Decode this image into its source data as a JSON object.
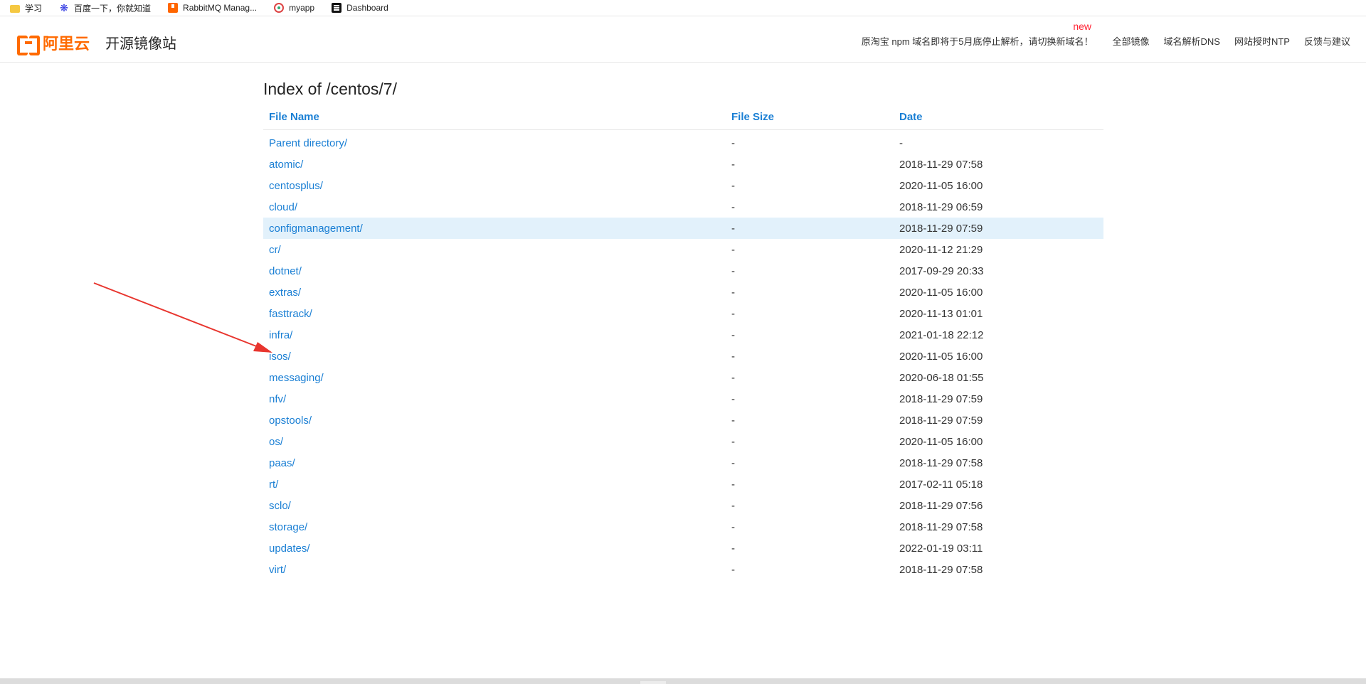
{
  "bookmarks": [
    {
      "label": "学习",
      "icon": "folder-icon"
    },
    {
      "label": "百度一下，你就知道",
      "icon": "baidu-paw-icon"
    },
    {
      "label": "RabbitMQ Manag...",
      "icon": "rabbitmq-icon"
    },
    {
      "label": "myapp",
      "icon": "myapp-icon"
    },
    {
      "label": "Dashboard",
      "icon": "dashboard-icon"
    }
  ],
  "header": {
    "logo_text": "阿里云",
    "site_title": "开源镜像站",
    "new_badge": "new",
    "notice": "原淘宝 npm 域名即将于5月底停止解析，请切换新域名！",
    "nav": [
      "全部镜像",
      "域名解析DNS",
      "网站授时NTP",
      "反馈与建议"
    ]
  },
  "listing": {
    "title": "Index of /centos/7/",
    "columns": [
      "File Name",
      "File Size",
      "Date"
    ],
    "rows": [
      {
        "name": "Parent directory/",
        "size": "-",
        "date": "-"
      },
      {
        "name": "atomic/",
        "size": "-",
        "date": "2018-11-29 07:58"
      },
      {
        "name": "centosplus/",
        "size": "-",
        "date": "2020-11-05 16:00"
      },
      {
        "name": "cloud/",
        "size": "-",
        "date": "2018-11-29 06:59"
      },
      {
        "name": "configmanagement/",
        "size": "-",
        "date": "2018-11-29 07:59"
      },
      {
        "name": "cr/",
        "size": "-",
        "date": "2020-11-12 21:29"
      },
      {
        "name": "dotnet/",
        "size": "-",
        "date": "2017-09-29 20:33"
      },
      {
        "name": "extras/",
        "size": "-",
        "date": "2020-11-05 16:00"
      },
      {
        "name": "fasttrack/",
        "size": "-",
        "date": "2020-11-13 01:01"
      },
      {
        "name": "infra/",
        "size": "-",
        "date": "2021-01-18 22:12"
      },
      {
        "name": "isos/",
        "size": "-",
        "date": "2020-11-05 16:00"
      },
      {
        "name": "messaging/",
        "size": "-",
        "date": "2020-06-18 01:55"
      },
      {
        "name": "nfv/",
        "size": "-",
        "date": "2018-11-29 07:59"
      },
      {
        "name": "opstools/",
        "size": "-",
        "date": "2018-11-29 07:59"
      },
      {
        "name": "os/",
        "size": "-",
        "date": "2020-11-05 16:00"
      },
      {
        "name": "paas/",
        "size": "-",
        "date": "2018-11-29 07:58"
      },
      {
        "name": "rt/",
        "size": "-",
        "date": "2017-02-11 05:18"
      },
      {
        "name": "sclo/",
        "size": "-",
        "date": "2018-11-29 07:56"
      },
      {
        "name": "storage/",
        "size": "-",
        "date": "2018-11-29 07:58"
      },
      {
        "name": "updates/",
        "size": "-",
        "date": "2022-01-19 03:11"
      },
      {
        "name": "virt/",
        "size": "-",
        "date": "2018-11-29 07:58"
      }
    ],
    "highlighted_row": 4
  },
  "colors": {
    "brand": "#ff6a00",
    "link": "#1a7fd4",
    "highlight": "#e2f1fb",
    "arrow": "#e8352e",
    "badge": "#ff2233"
  }
}
